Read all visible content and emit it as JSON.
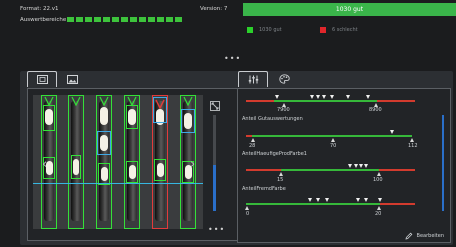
{
  "header": {
    "format_text": "Format: 22.v1",
    "version_text": "Version: 7",
    "areas_label": "Auswertbereiche",
    "status_banner": "1030 gut",
    "legend": [
      {
        "label": "1030 gut",
        "color": "#2bd12b"
      },
      {
        "label": "6 schlecht",
        "color": "#e1262b"
      }
    ]
  },
  "left_panel": {
    "tabs": [
      {
        "name": "image-overlay-tab",
        "icon": "image-frame-icon"
      },
      {
        "name": "image-tab",
        "icon": "image-icon"
      }
    ]
  },
  "right_panel": {
    "tabs": [
      {
        "name": "sliders-tab",
        "icon": "sliders-icon"
      },
      {
        "name": "color-tab",
        "icon": "palette-icon"
      }
    ],
    "sections": [
      {
        "label": "",
        "ticks": [
          "7900",
          "8900"
        ]
      },
      {
        "label": "Anteil Gutauswertungen",
        "ticks": [
          "28",
          "70",
          "112"
        ]
      },
      {
        "label": "AnteilHaeufigeProdFarbe1",
        "ticks": [
          "15",
          "100"
        ]
      },
      {
        "label": "AnteilFremdFarbe",
        "ticks": [
          "0",
          "20"
        ]
      }
    ],
    "edit_label": "Bearbeiten"
  }
}
